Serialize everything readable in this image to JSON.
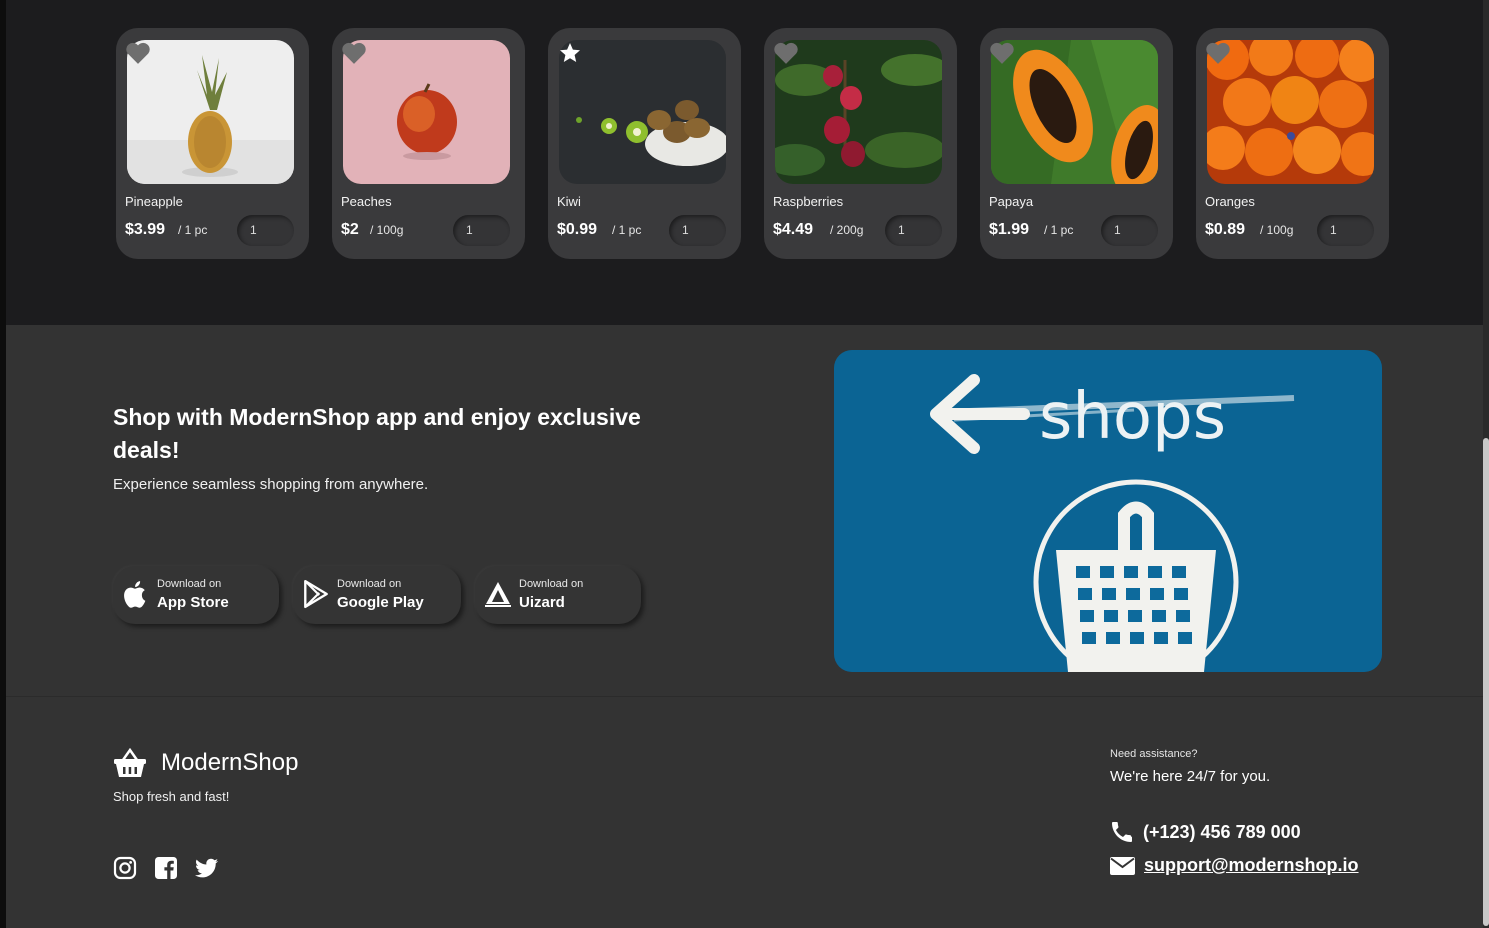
{
  "products": [
    {
      "name": "Pineapple",
      "price": "$3.99",
      "unit": "/ 1 pc",
      "qty": "1",
      "favorite": false,
      "image": "pineapple-photo"
    },
    {
      "name": "Peaches",
      "price": "$2",
      "unit": "/ 100g",
      "qty": "1",
      "favorite": false,
      "image": "peach-photo"
    },
    {
      "name": "Kiwi",
      "price": "$0.99",
      "unit": "/ 1 pc",
      "qty": "1",
      "favorite": true,
      "image": "kiwi-photo"
    },
    {
      "name": "Raspberries",
      "price": "$4.49",
      "unit": "/ 200g",
      "qty": "1",
      "favorite": false,
      "image": "raspberries-photo"
    },
    {
      "name": "Papaya",
      "price": "$1.99",
      "unit": "/ 1 pc",
      "qty": "1",
      "favorite": false,
      "image": "papaya-photo"
    },
    {
      "name": "Oranges",
      "price": "$0.89",
      "unit": "/ 100g",
      "qty": "1",
      "favorite": false,
      "image": "oranges-photo"
    }
  ],
  "promo": {
    "title": "Shop with ModernShop app and enjoy exclusive deals!",
    "subtitle": "Experience seamless shopping from anywhere.",
    "stores": [
      {
        "top": "Download on",
        "name": "App Store",
        "icon": "apple-icon"
      },
      {
        "top": "Download on",
        "name": "Google Play",
        "icon": "google-play-icon"
      },
      {
        "top": "Download on",
        "name": "Uizard",
        "icon": "uizard-icon"
      }
    ],
    "image_text": "shops"
  },
  "footer": {
    "brand": "ModernShop",
    "tagline": "Shop fresh and fast!",
    "assist_small": "Need assistance?",
    "assist_big": "We're here 24/7 for you.",
    "phone": "(+123) 456 789 000",
    "email": "support@modernshop.io",
    "socials": [
      "instagram-icon",
      "facebook-icon",
      "twitter-icon"
    ]
  },
  "colors": {
    "page_bg": "#333333",
    "products_bg": "#1c1c1e",
    "card_bg": "#3a3a3c",
    "promo_image_blue": "#0d6a9c"
  }
}
